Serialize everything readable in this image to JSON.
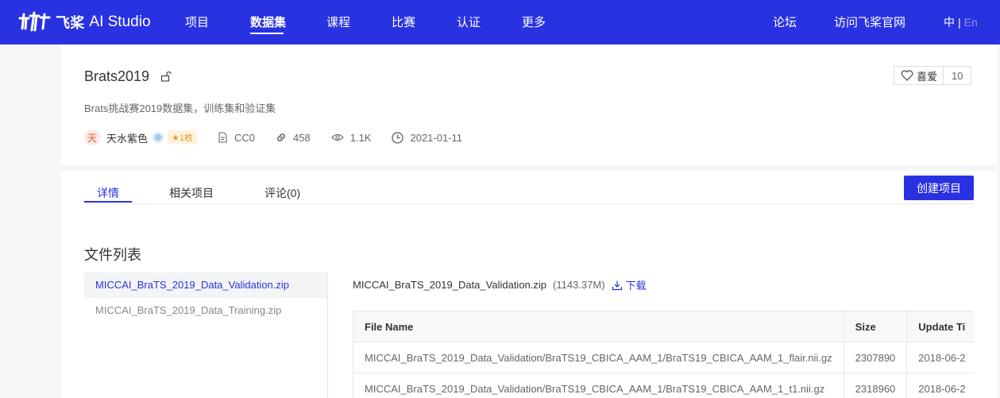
{
  "nav": {
    "brand": "飞桨",
    "brand_sub": "AI Studio",
    "items": [
      "项目",
      "数据集",
      "课程",
      "比赛",
      "认证",
      "更多"
    ],
    "active_index": 1,
    "right_links": [
      "论坛",
      "访问飞桨官网"
    ],
    "lang_zh": "中",
    "lang_sep": "|",
    "lang_en": "En"
  },
  "dataset": {
    "title": "Brats2019",
    "description": "Brats挑战赛2019数据集，训练集和验证集",
    "author_avatar": "天",
    "author": "天水紫色",
    "badge": "1枚",
    "license": "CC0",
    "forks": "458",
    "views": "1.1K",
    "date": "2021-01-11",
    "like_label": "喜爱",
    "like_count": "10"
  },
  "tabs": [
    "详情",
    "相关项目",
    "评论(0)"
  ],
  "create_button": "创建项目",
  "files": {
    "heading": "文件列表",
    "items": [
      "MICCAI_BraTS_2019_Data_Validation.zip",
      "MICCAI_BraTS_2019_Data_Training.zip"
    ],
    "selected_name": "MICCAI_BraTS_2019_Data_Validation.zip",
    "selected_size": "(1143.37M)",
    "download_label": "下载",
    "table": {
      "columns": [
        "File Name",
        "Size",
        "Update Ti"
      ],
      "rows": [
        [
          "MICCAI_BraTS_2019_Data_Validation/BraTS19_CBICA_AAM_1/BraTS19_CBICA_AAM_1_flair.nii.gz",
          "2307890",
          "2018-06-2"
        ],
        [
          "MICCAI_BraTS_2019_Data_Validation/BraTS19_CBICA_AAM_1/BraTS19_CBICA_AAM_1_t1.nii.gz",
          "2318960",
          "2018-06-2"
        ]
      ]
    }
  },
  "colors": {
    "brand_blue": "#2932e1"
  },
  "icons": [
    "paddle-logo-icon",
    "unlock-icon",
    "heart-icon",
    "verify-icon",
    "license-icon",
    "link-icon",
    "eye-icon",
    "clock-icon",
    "download-icon"
  ]
}
